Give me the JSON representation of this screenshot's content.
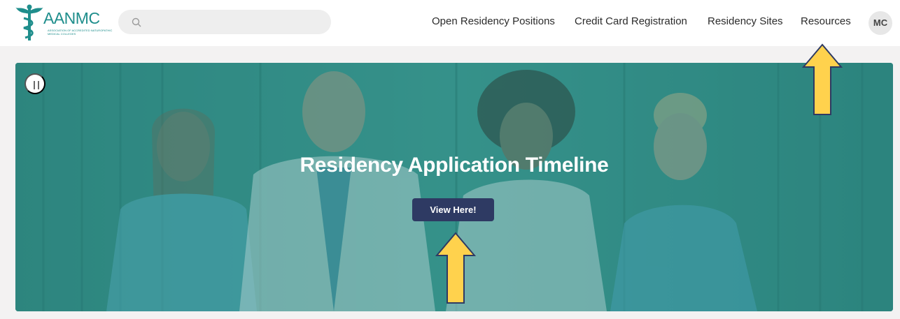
{
  "brand": {
    "name": "AANMC",
    "tagline": "Association of Accredited Naturopathic Medical Colleges",
    "color": "#1f8e8c"
  },
  "search": {
    "placeholder": "",
    "value": "",
    "icon": "search-icon"
  },
  "nav": {
    "items": [
      {
        "label": "Open Residency Positions"
      },
      {
        "label": "Credit Card Registration"
      },
      {
        "label": "Residency Sites"
      },
      {
        "label": "Resources"
      }
    ],
    "avatar_initials": "MC"
  },
  "hero": {
    "title": "Residency Application Timeline",
    "cta_label": "View Here!",
    "overlay_color": "#2f8a84",
    "cta_color": "#2e3a63",
    "pause_icon": "pause-icon"
  },
  "annotations": {
    "arrow_color": "#ffd24d"
  }
}
